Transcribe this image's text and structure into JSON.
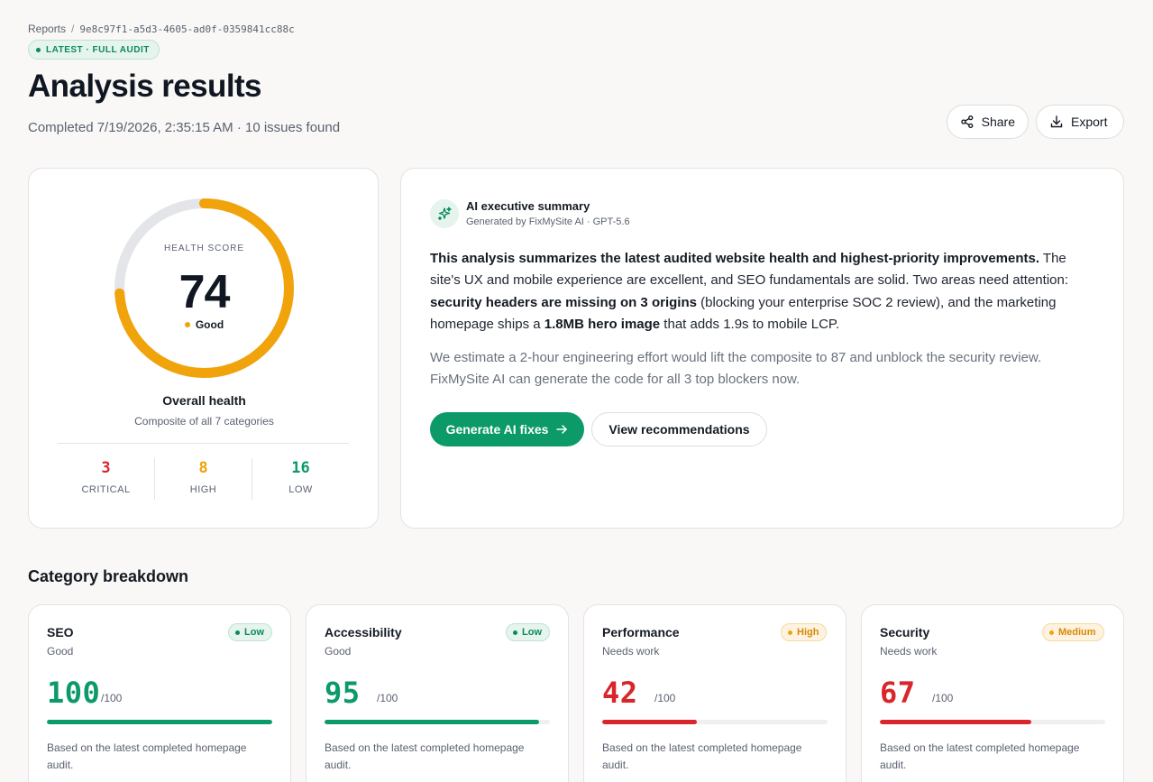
{
  "breadcrumb": {
    "root": "Reports",
    "separator": "/",
    "report_id": "9e8c97f1-a5d3-4605-ad0f-0359841cc88c"
  },
  "latest_badge": "LATEST · FULL AUDIT",
  "title": "Analysis results",
  "subtitle": "Completed 7/19/2026, 2:35:15 AM · 10 issues found",
  "actions": {
    "share": "Share",
    "export": "Export"
  },
  "health": {
    "label": "HEALTH SCORE",
    "score": "74",
    "score_value": 74,
    "status": "Good",
    "title": "Overall health",
    "subtitle": "Composite of all 7 categories",
    "gauge_color": "#f0a30a",
    "severity": [
      {
        "count": "3",
        "label": "CRITICAL",
        "color": "#d8262b"
      },
      {
        "count": "8",
        "label": "HIGH",
        "color": "#f0a30a"
      },
      {
        "count": "16",
        "label": "LOW",
        "color": "#0b9a68"
      }
    ]
  },
  "summary": {
    "icon": "sparkles-icon",
    "title": "AI executive summary",
    "generated_by": "Generated by FixMySite AI · GPT-5.6",
    "p1_bold_1": "This analysis summarizes the latest audited website health and highest-priority improvements.",
    "p1_text_1": " The site's UX and mobile experience are excellent, and SEO fundamentals are solid. Two areas need attention: ",
    "p1_bold_2": "security headers are missing on 3 origins",
    "p1_text_2": " (blocking your enterprise SOC 2 review), and the marketing homepage ships a ",
    "p1_bold_3": "1.8MB hero image",
    "p1_text_3": " that adds 1.9s to mobile LCP.",
    "p2": "We estimate a 2-hour engineering effort would lift the composite to 87 and unblock the security review. FixMySite AI can generate the code for all 3 top blockers now.",
    "primary_button": "Generate AI fixes",
    "secondary_button": "View recommendations"
  },
  "categories_title": "Category breakdown",
  "categories": [
    {
      "name": "SEO",
      "status": "Good",
      "badge": "Low",
      "score": "100",
      "score_value": 100,
      "max": "/100",
      "color": "#0b9a68",
      "note": "Based on the latest completed homepage audit."
    },
    {
      "name": "Accessibility",
      "status": "Good",
      "badge": "Low",
      "score": "95",
      "score_value": 95,
      "max": "/100",
      "color": "#0b9a68",
      "note": "Based on the latest completed homepage audit."
    },
    {
      "name": "Performance",
      "status": "Needs work",
      "badge": "High",
      "score": "42",
      "score_value": 42,
      "max": "/100",
      "color": "#d8262b",
      "note": "Based on the latest completed homepage audit."
    },
    {
      "name": "Security",
      "status": "Needs work",
      "badge": "Medium",
      "score": "67",
      "score_value": 67,
      "max": "/100",
      "color": "#d8262b",
      "note": "Based on the latest completed homepage audit."
    }
  ]
}
